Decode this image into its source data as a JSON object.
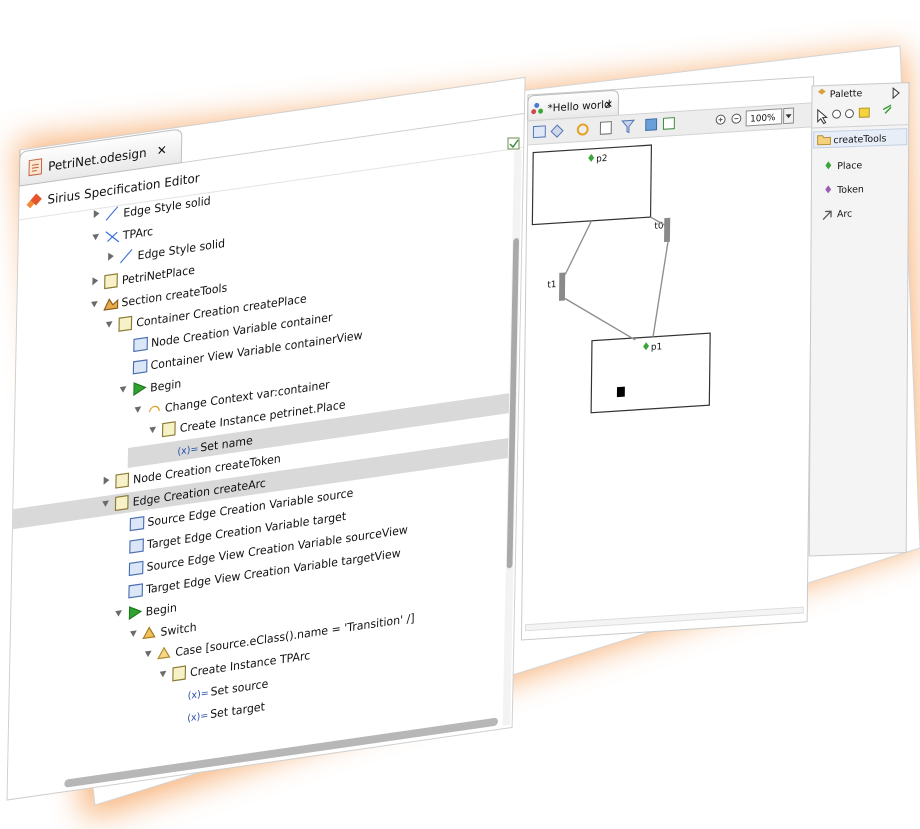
{
  "editor": {
    "tab_label": "PetriNet.odesign",
    "close_glyph": "✕",
    "subtitle": "Sirius Specification Editor",
    "tree": [
      {
        "label": "Edge Style solid",
        "icon": "edge-style-icon"
      },
      {
        "label": "TPArc",
        "icon": "edge-mapping-icon"
      },
      {
        "label": "Edge Style solid",
        "icon": "edge-style-icon"
      },
      {
        "label": "PetriNetPlace",
        "icon": "container-mapping-icon"
      },
      {
        "label": "Section createTools",
        "icon": "section-icon"
      },
      {
        "label": "Container Creation createPlace",
        "icon": "container-creation-icon"
      },
      {
        "label": "Node Creation Variable container",
        "icon": "variable-icon"
      },
      {
        "label": "Container View Variable containerView",
        "icon": "variable-icon"
      },
      {
        "label": "Begin",
        "icon": "begin-icon"
      },
      {
        "label": "Change Context var:container",
        "icon": "change-context-icon"
      },
      {
        "label": "Create Instance petrinet.Place",
        "icon": "create-instance-icon"
      },
      {
        "label": "Set name",
        "icon": "set-icon"
      },
      {
        "label": "Node Creation createToken",
        "icon": "node-creation-icon"
      },
      {
        "label": "Edge Creation createArc",
        "icon": "edge-creation-icon"
      },
      {
        "label": "Source Edge Creation Variable source",
        "icon": "variable-icon"
      },
      {
        "label": "Target Edge Creation Variable target",
        "icon": "variable-icon"
      },
      {
        "label": "Source Edge View Creation Variable sourceView",
        "icon": "variable-icon"
      },
      {
        "label": "Target Edge View Creation Variable targetView",
        "icon": "variable-icon"
      },
      {
        "label": "Begin",
        "icon": "begin-icon"
      },
      {
        "label": "Switch",
        "icon": "switch-icon"
      },
      {
        "label": "Case [source.eClass().name = 'Transition' /]",
        "icon": "case-icon"
      },
      {
        "label": "Create Instance TPArc",
        "icon": "create-instance-icon"
      },
      {
        "label": "Set source",
        "icon": "set-icon"
      },
      {
        "label": "Set target",
        "icon": "set-icon"
      }
    ],
    "set_prefix": "(x)="
  },
  "diagram": {
    "tab_label": "*Hello world",
    "close_glyph": "✕",
    "zoom_value": "100%",
    "nodes": [
      {
        "label": "p2"
      },
      {
        "label": "p1"
      },
      {
        "label": "t1"
      },
      {
        "label": "t0"
      }
    ]
  },
  "palette": {
    "title": "Palette",
    "group_label": "createTools",
    "tools": [
      {
        "label": "Place",
        "icon": "place-tool-icon"
      },
      {
        "label": "Token",
        "icon": "token-tool-icon"
      },
      {
        "label": "Arc",
        "icon": "arc-tool-icon"
      }
    ]
  },
  "colors": {
    "glow": "#f7a968",
    "selection": "#d9d9d9",
    "begin_green": "#2fa32f",
    "place_green": "#3aa63a",
    "token_purple": "#9b5db5"
  }
}
